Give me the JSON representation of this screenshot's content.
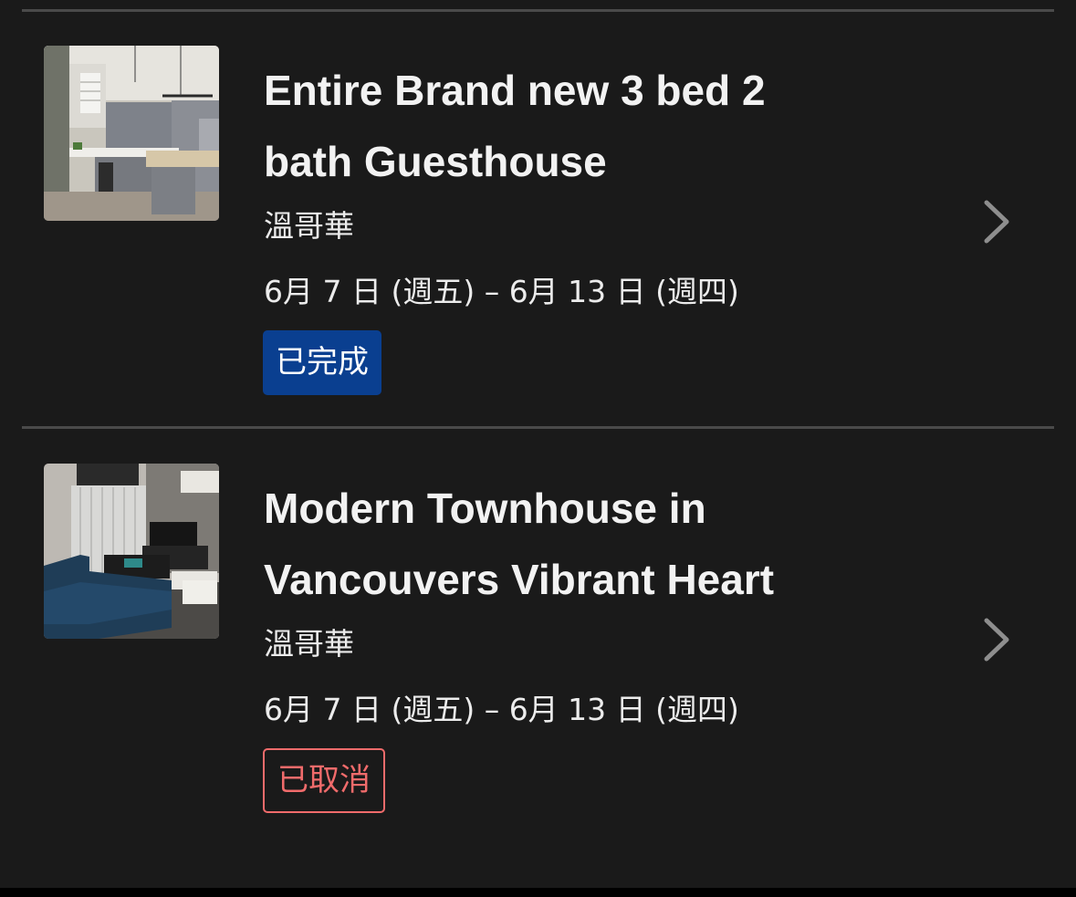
{
  "bookings": [
    {
      "title_line1": "Entire Brand new 3 bed 2",
      "title_line2": "bath Guesthouse",
      "city": "溫哥華",
      "dates": "6月 7 日 (週五) – 6月 13 日 (週四)",
      "status": "已完成",
      "status_color": "#0a3f90",
      "thumbnail": "kitchen-photo",
      "chevron_icon": "chevron-right-icon"
    },
    {
      "title_line1": "Modern Townhouse in",
      "title_line2": "Vancouvers Vibrant Heart",
      "city": "溫哥華",
      "dates": "6月 7 日 (週五) – 6月 13 日 (週四)",
      "status": "已取消",
      "status_color": "#f06b6b",
      "thumbnail": "living-room-photo",
      "chevron_icon": "chevron-right-icon"
    }
  ],
  "colors": {
    "background": "#1a1a1a",
    "divider": "#4a4a4a",
    "text": "#f2f2f2",
    "chevron": "#8e8e8e"
  }
}
